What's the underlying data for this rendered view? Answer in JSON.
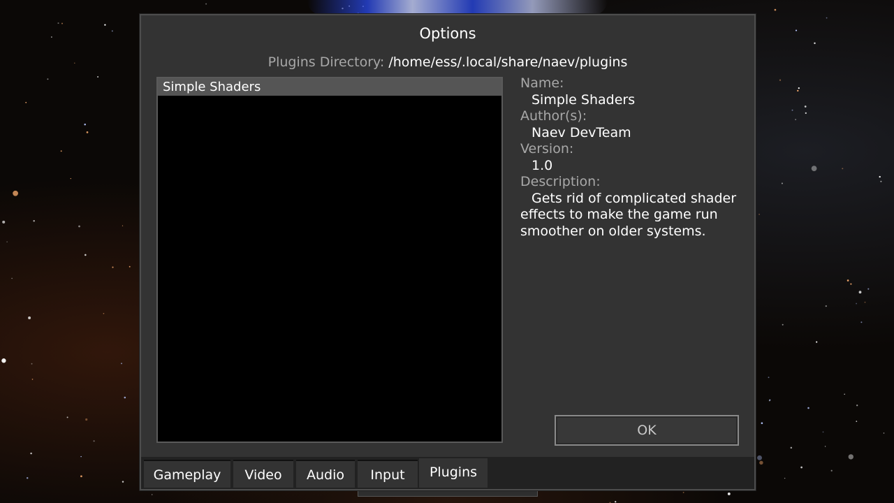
{
  "window": {
    "title": "Options"
  },
  "plugins_directory": {
    "label": "Plugins Directory:",
    "value": "/home/ess/.local/share/naev/plugins"
  },
  "plugin_list": {
    "items": [
      {
        "label": "Simple Shaders",
        "selected": true
      }
    ]
  },
  "details": {
    "name_label": "Name:",
    "name_value": "Simple Shaders",
    "author_label": "Author(s):",
    "author_value": "Naev DevTeam",
    "version_label": "Version:",
    "version_value": "1.0",
    "description_label": "Description:",
    "description_value": "Gets rid of complicated shader effects to make the game run smoother on older systems."
  },
  "buttons": {
    "ok_label": "OK"
  },
  "tabs": [
    {
      "label": "Gameplay",
      "active": false
    },
    {
      "label": "Video",
      "active": false
    },
    {
      "label": "Audio",
      "active": false
    },
    {
      "label": "Input",
      "active": false
    },
    {
      "label": "Plugins",
      "active": true
    }
  ],
  "colors": {
    "window_bg": "#333333",
    "label_gray": "#a8a8a8",
    "text_white": "#ffffff",
    "selected_row": "#555555"
  }
}
